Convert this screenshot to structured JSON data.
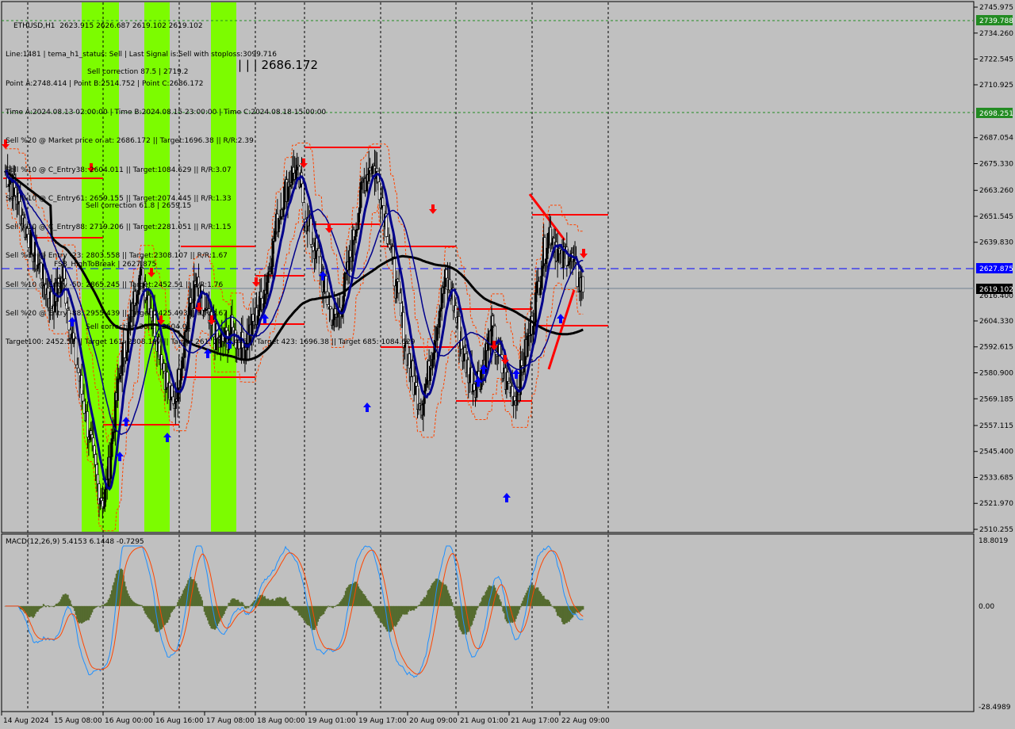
{
  "header": {
    "symbol_line": "ETHUSD,H1  2623.915 2626.687 2619.102 2619.102",
    "lines": [
      "Line:1481 | tema_h1_status: Sell | Last Signal is:Sell with stoploss:3099.716",
      "Point A:2748.414 | Point B:2514.752 | Point C:2686.172",
      "Time A:2024.08.13 02:00:00 | Time B:2024.08.15 23:00:00 | Time C:2024.08.18 15:00:00",
      "Sell %20 @ Market price or at: 2686.172 || Target:1696.38 || R/R:2.39",
      "Sell %10 @ C_Entry38: 2604.011 || Target:1084.629 || R/R:3.07",
      "Sell %10 @ C_Entry61: 2659.155 || Target:2074.445 || R/R:1.33",
      "Sell %10 @ C_Entry88: 2719.206 || Target:2281.051 || R/R:1.15",
      "Sell %10 @ Entry -23: 2803.558 || Target:2308.107 || R/R:1.67",
      "Sell %10 @ Entry -50: 2865.245 || Target:2452.51 || R/R:1.76",
      "Sell %20 @ Entry -88: 2955.439 || Target:2425.493 || R/R:3.67",
      "Target100: 2452.51 || Target 161: 2308.107 || Target 261: 2074.445 || Target 423: 1696.38 || Target 685: 1084.629"
    ],
    "big_price": "| | | 2686.172"
  },
  "annotations": {
    "sell_correction_618": "Sell correction 61.8 | 2659.15",
    "sell_correction_382": "Sell correction 38.2 | 2604.01",
    "sell_correction_87": "Sell correction 87.5 | 2719.2",
    "fsb_break": "FSB_HighToBreak | 2627.875"
  },
  "price_axis": {
    "labels": [
      "2745.975",
      "2734.260",
      "2722.545",
      "2710.925",
      "2687.054",
      "2675.330",
      "2663.260",
      "2651.545",
      "2639.830",
      "2604.330",
      "2592.615",
      "2580.900",
      "2569.185",
      "2557.115",
      "2545.400",
      "2533.685",
      "2521.970",
      "2510.255"
    ],
    "tag_green_top": "2739.788",
    "tag_green_mid": "2698.251",
    "tag_blue": "2627.875",
    "tag_current": "2619.102",
    "tag_current_below": "2616.400"
  },
  "macd_axis": {
    "title": "MACD(12,26,9) 5.4153 6.1448 -0.7295",
    "top": "18.8019",
    "zero": "0.00",
    "bottom": "-28.4989"
  },
  "time_axis": [
    "14 Aug 2024",
    "15 Aug 08:00",
    "16 Aug 00:00",
    "16 Aug 16:00",
    "17 Aug 08:00",
    "18 Aug 00:00",
    "19 Aug 01:00",
    "19 Aug 17:00",
    "20 Aug 09:00",
    "21 Aug 01:00",
    "21 Aug 17:00",
    "22 Aug 09:00"
  ],
  "colors": {
    "background": "#c0c0c0",
    "bull_candle": "#000000",
    "green_zone": "#7cfc00",
    "ma_blue": "#00008b",
    "ma_black": "#000000",
    "red": "#ff0000",
    "tag_green": "#228b22",
    "tag_blue": "#0000ff",
    "macd_hist": "#556b2f",
    "macd_line": "#1e90ff",
    "signal_line": "#ff4500"
  },
  "chart_data": {
    "type": "candlestick",
    "symbol": "ETHUSD",
    "timeframe": "H1",
    "ohlc_last": {
      "open": 2623.915,
      "high": 2626.687,
      "low": 2619.102,
      "close": 2619.102
    },
    "price_range": [
      2510.255,
      2745.975
    ],
    "macd_range": [
      -28.4989,
      18.8019
    ],
    "close_path": [
      2672,
      2668,
      2660,
      2650,
      2642,
      2635,
      2628,
      2620,
      2612,
      2618,
      2625,
      2606,
      2590,
      2575,
      2560,
      2545,
      2530,
      2522,
      2540,
      2565,
      2585,
      2595,
      2610,
      2625,
      2622,
      2612,
      2600,
      2588,
      2575,
      2565,
      2580,
      2598,
      2612,
      2620,
      2612,
      2604,
      2598,
      2594,
      2596,
      2600,
      2596,
      2592,
      2598,
      2604,
      2612,
      2620,
      2635,
      2650,
      2660,
      2668,
      2672,
      2665,
      2650,
      2640,
      2633,
      2620,
      2610,
      2604,
      2612,
      2625,
      2640,
      2655,
      2668,
      2675,
      2672,
      2660,
      2645,
      2628,
      2612,
      2596,
      2582,
      2572,
      2568,
      2580,
      2595,
      2610,
      2622,
      2618,
      2604,
      2590,
      2582,
      2576,
      2580,
      2590,
      2600,
      2590,
      2580,
      2575,
      2570,
      2580,
      2592,
      2604,
      2620,
      2635,
      2645,
      2640,
      2630,
      2636,
      2630,
      2622,
      2619
    ]
  }
}
